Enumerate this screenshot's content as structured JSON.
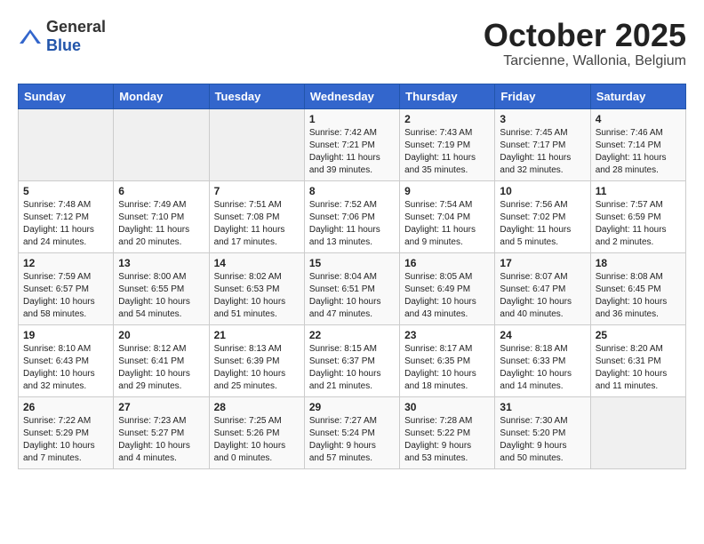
{
  "logo": {
    "text_general": "General",
    "text_blue": "Blue"
  },
  "header": {
    "month": "October 2025",
    "location": "Tarcienne, Wallonia, Belgium"
  },
  "weekdays": [
    "Sunday",
    "Monday",
    "Tuesday",
    "Wednesday",
    "Thursday",
    "Friday",
    "Saturday"
  ],
  "weeks": [
    [
      {
        "day": "",
        "info": ""
      },
      {
        "day": "",
        "info": ""
      },
      {
        "day": "",
        "info": ""
      },
      {
        "day": "1",
        "info": "Sunrise: 7:42 AM\nSunset: 7:21 PM\nDaylight: 11 hours\nand 39 minutes."
      },
      {
        "day": "2",
        "info": "Sunrise: 7:43 AM\nSunset: 7:19 PM\nDaylight: 11 hours\nand 35 minutes."
      },
      {
        "day": "3",
        "info": "Sunrise: 7:45 AM\nSunset: 7:17 PM\nDaylight: 11 hours\nand 32 minutes."
      },
      {
        "day": "4",
        "info": "Sunrise: 7:46 AM\nSunset: 7:14 PM\nDaylight: 11 hours\nand 28 minutes."
      }
    ],
    [
      {
        "day": "5",
        "info": "Sunrise: 7:48 AM\nSunset: 7:12 PM\nDaylight: 11 hours\nand 24 minutes."
      },
      {
        "day": "6",
        "info": "Sunrise: 7:49 AM\nSunset: 7:10 PM\nDaylight: 11 hours\nand 20 minutes."
      },
      {
        "day": "7",
        "info": "Sunrise: 7:51 AM\nSunset: 7:08 PM\nDaylight: 11 hours\nand 17 minutes."
      },
      {
        "day": "8",
        "info": "Sunrise: 7:52 AM\nSunset: 7:06 PM\nDaylight: 11 hours\nand 13 minutes."
      },
      {
        "day": "9",
        "info": "Sunrise: 7:54 AM\nSunset: 7:04 PM\nDaylight: 11 hours\nand 9 minutes."
      },
      {
        "day": "10",
        "info": "Sunrise: 7:56 AM\nSunset: 7:02 PM\nDaylight: 11 hours\nand 5 minutes."
      },
      {
        "day": "11",
        "info": "Sunrise: 7:57 AM\nSunset: 6:59 PM\nDaylight: 11 hours\nand 2 minutes."
      }
    ],
    [
      {
        "day": "12",
        "info": "Sunrise: 7:59 AM\nSunset: 6:57 PM\nDaylight: 10 hours\nand 58 minutes."
      },
      {
        "day": "13",
        "info": "Sunrise: 8:00 AM\nSunset: 6:55 PM\nDaylight: 10 hours\nand 54 minutes."
      },
      {
        "day": "14",
        "info": "Sunrise: 8:02 AM\nSunset: 6:53 PM\nDaylight: 10 hours\nand 51 minutes."
      },
      {
        "day": "15",
        "info": "Sunrise: 8:04 AM\nSunset: 6:51 PM\nDaylight: 10 hours\nand 47 minutes."
      },
      {
        "day": "16",
        "info": "Sunrise: 8:05 AM\nSunset: 6:49 PM\nDaylight: 10 hours\nand 43 minutes."
      },
      {
        "day": "17",
        "info": "Sunrise: 8:07 AM\nSunset: 6:47 PM\nDaylight: 10 hours\nand 40 minutes."
      },
      {
        "day": "18",
        "info": "Sunrise: 8:08 AM\nSunset: 6:45 PM\nDaylight: 10 hours\nand 36 minutes."
      }
    ],
    [
      {
        "day": "19",
        "info": "Sunrise: 8:10 AM\nSunset: 6:43 PM\nDaylight: 10 hours\nand 32 minutes."
      },
      {
        "day": "20",
        "info": "Sunrise: 8:12 AM\nSunset: 6:41 PM\nDaylight: 10 hours\nand 29 minutes."
      },
      {
        "day": "21",
        "info": "Sunrise: 8:13 AM\nSunset: 6:39 PM\nDaylight: 10 hours\nand 25 minutes."
      },
      {
        "day": "22",
        "info": "Sunrise: 8:15 AM\nSunset: 6:37 PM\nDaylight: 10 hours\nand 21 minutes."
      },
      {
        "day": "23",
        "info": "Sunrise: 8:17 AM\nSunset: 6:35 PM\nDaylight: 10 hours\nand 18 minutes."
      },
      {
        "day": "24",
        "info": "Sunrise: 8:18 AM\nSunset: 6:33 PM\nDaylight: 10 hours\nand 14 minutes."
      },
      {
        "day": "25",
        "info": "Sunrise: 8:20 AM\nSunset: 6:31 PM\nDaylight: 10 hours\nand 11 minutes."
      }
    ],
    [
      {
        "day": "26",
        "info": "Sunrise: 7:22 AM\nSunset: 5:29 PM\nDaylight: 10 hours\nand 7 minutes."
      },
      {
        "day": "27",
        "info": "Sunrise: 7:23 AM\nSunset: 5:27 PM\nDaylight: 10 hours\nand 4 minutes."
      },
      {
        "day": "28",
        "info": "Sunrise: 7:25 AM\nSunset: 5:26 PM\nDaylight: 10 hours\nand 0 minutes."
      },
      {
        "day": "29",
        "info": "Sunrise: 7:27 AM\nSunset: 5:24 PM\nDaylight: 9 hours\nand 57 minutes."
      },
      {
        "day": "30",
        "info": "Sunrise: 7:28 AM\nSunset: 5:22 PM\nDaylight: 9 hours\nand 53 minutes."
      },
      {
        "day": "31",
        "info": "Sunrise: 7:30 AM\nSunset: 5:20 PM\nDaylight: 9 hours\nand 50 minutes."
      },
      {
        "day": "",
        "info": ""
      }
    ]
  ]
}
